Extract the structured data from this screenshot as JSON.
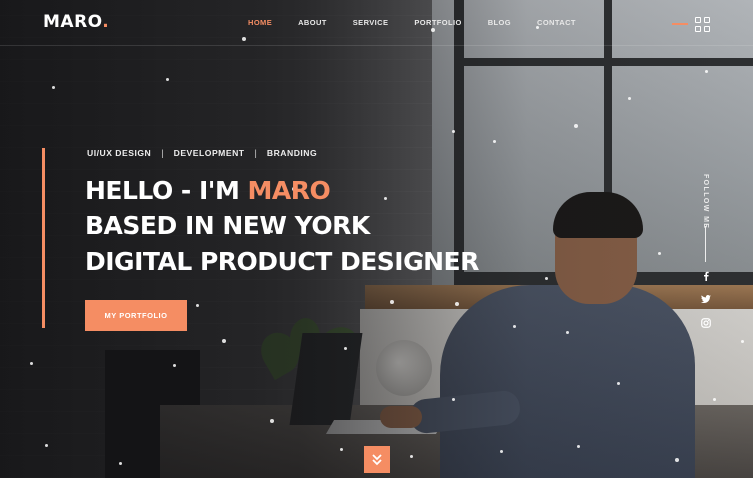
{
  "brand": {
    "name": "MARO",
    "dot": ".",
    "accent": "#f58d63"
  },
  "nav": [
    {
      "label": "HOME",
      "active": true
    },
    {
      "label": "ABOUT",
      "active": false
    },
    {
      "label": "SERVICE",
      "active": false
    },
    {
      "label": "PORTFOLIO",
      "active": false
    },
    {
      "label": "BLOG",
      "active": false
    },
    {
      "label": "CONTACT",
      "active": false
    }
  ],
  "menu_icon": "grid-menu-icon",
  "hero": {
    "tags": [
      "UI/UX DESIGN",
      "DEVELOPMENT",
      "BRANDING"
    ],
    "tag_separator": "|",
    "headline_prefix": "HELLO - I'M ",
    "headline_name": "MARO",
    "headline_line2": "BASED IN NEW YORK",
    "headline_line3": "DIGITAL PRODUCT DESIGNER",
    "cta_label": "MY PORTFOLIO"
  },
  "social": {
    "follow_label": "FOLLOW ME",
    "links": [
      {
        "name": "facebook-icon"
      },
      {
        "name": "twitter-icon"
      },
      {
        "name": "instagram-icon"
      }
    ]
  },
  "scroll_icon": "chevron-double-down-icon"
}
